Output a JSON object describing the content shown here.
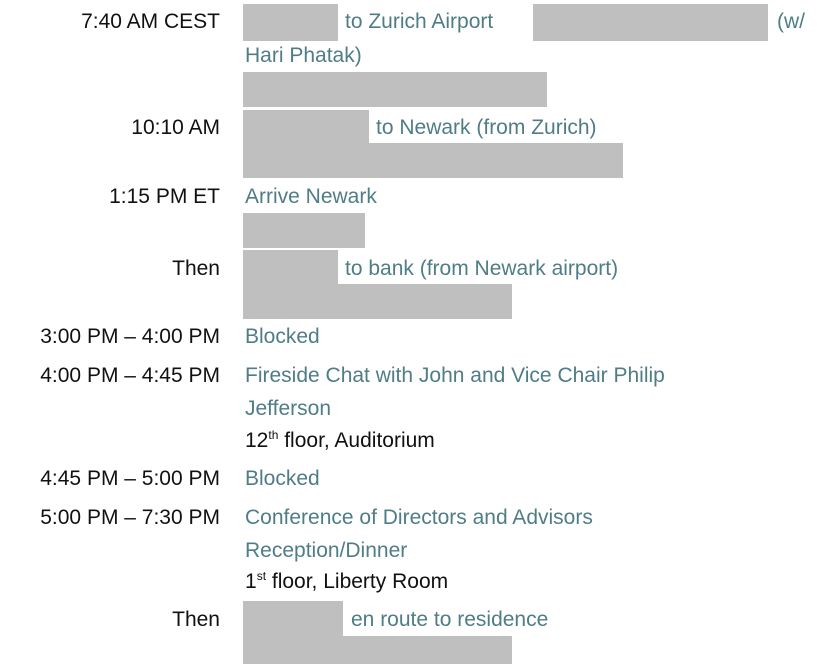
{
  "colors": {
    "event_text": "#4f7d87",
    "time_text": "#111111",
    "redaction": "#bfbfbf"
  },
  "schedule": [
    {
      "time": "7:40 AM CEST",
      "seg1": "to Zurich Airport",
      "seg2": "(w/",
      "line2": "Hari Phatak)"
    },
    {
      "time": "10:10 AM",
      "seg1": "to Newark (from Zurich)"
    },
    {
      "time": "1:15 PM ET",
      "seg1": "Arrive Newark"
    },
    {
      "time": "Then",
      "seg1": "to bank (from Newark airport)"
    },
    {
      "time": "3:00 PM – 4:00 PM",
      "event": "Blocked"
    },
    {
      "time": "4:00 PM – 4:45 PM",
      "event_line1": "Fireside Chat with John and Vice Chair Philip",
      "event_line2": "Jefferson",
      "loc_num": "12",
      "loc_sup": "th",
      "loc_rest": " floor, Auditorium"
    },
    {
      "time": "4:45 PM – 5:00 PM",
      "event": "Blocked"
    },
    {
      "time": "5:00 PM – 7:30 PM",
      "event_line1": "Conference of Directors and Advisors",
      "event_line2": "Reception/Dinner",
      "loc_num": "1",
      "loc_sup": "st",
      "loc_rest": " floor, Liberty Room"
    },
    {
      "time": "Then",
      "seg1": "en route to residence"
    }
  ]
}
